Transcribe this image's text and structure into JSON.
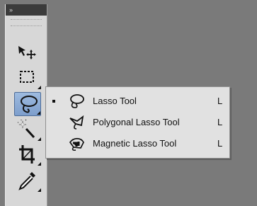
{
  "toolbar": {
    "collapse_glyph": "»",
    "tools": [
      {
        "name": "move-tool",
        "icon": "move-icon"
      },
      {
        "name": "rectangular-marquee-tool",
        "icon": "marquee-icon"
      },
      {
        "name": "lasso-tool",
        "icon": "lasso-icon",
        "selected": true
      },
      {
        "name": "quick-selection-tool",
        "icon": "magic-wand-icon"
      },
      {
        "name": "crop-tool",
        "icon": "crop-icon"
      },
      {
        "name": "eyedropper-tool",
        "icon": "eyedropper-icon"
      }
    ]
  },
  "flyout": {
    "items": [
      {
        "label": "Lasso Tool",
        "shortcut": "L",
        "icon": "lasso-icon",
        "active": true
      },
      {
        "label": "Polygonal Lasso Tool",
        "shortcut": "L",
        "icon": "polygonal-lasso-icon",
        "active": false
      },
      {
        "label": "Magnetic Lasso Tool",
        "shortcut": "L",
        "icon": "magnetic-lasso-icon",
        "active": false
      }
    ]
  },
  "colors": {
    "background": "#7a7a7a",
    "toolbar": "#d7d7d7",
    "toolbar_header": "#3b3b3b",
    "selected_tool": "#8fb0de",
    "flyout": "#e1e1e1",
    "text": "#111111"
  }
}
